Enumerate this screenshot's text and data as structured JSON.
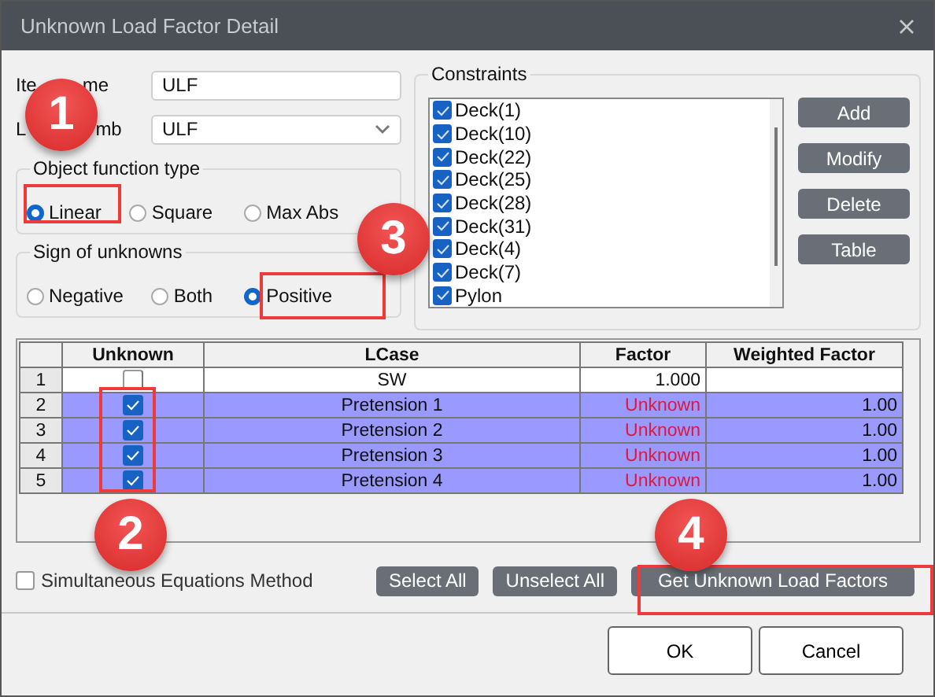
{
  "window": {
    "title": "Unknown Load Factor Detail"
  },
  "fields": [
    {
      "label": [
        "Ite",
        "me"
      ],
      "value": "ULF",
      "kind": "text"
    },
    {
      "label": [
        "L",
        "mb"
      ],
      "value": "ULF",
      "kind": "dropdown"
    }
  ],
  "function_type": {
    "title": "Object function type",
    "options": [
      {
        "label": "Linear",
        "selected": true
      },
      {
        "label": "Square",
        "selected": false
      },
      {
        "label": "Max Abs",
        "selected": false
      }
    ]
  },
  "sign": {
    "title": "Sign of unknowns",
    "options": [
      {
        "label": "Negative",
        "selected": false
      },
      {
        "label": "Both",
        "selected": false
      },
      {
        "label": "Positive",
        "selected": true
      }
    ]
  },
  "constraints": {
    "title": "Constraints",
    "items": [
      {
        "label": "Deck(1)",
        "checked": true
      },
      {
        "label": "Deck(10)",
        "checked": true
      },
      {
        "label": "Deck(22)",
        "checked": true
      },
      {
        "label": "Deck(25)",
        "checked": true
      },
      {
        "label": "Deck(28)",
        "checked": true
      },
      {
        "label": "Deck(31)",
        "checked": true
      },
      {
        "label": "Deck(4)",
        "checked": true
      },
      {
        "label": "Deck(7)",
        "checked": true
      },
      {
        "label": "Pylon",
        "checked": true
      }
    ],
    "buttons": [
      "Add",
      "Modify",
      "Delete",
      "Table"
    ]
  },
  "table": {
    "columns": [
      "Unknown",
      "LCase",
      "Factor",
      "Weighted Factor"
    ],
    "rows": [
      {
        "number": "1",
        "unknown": false,
        "lcase": "SW",
        "factor": "1.000",
        "selected": false
      },
      {
        "number": "2",
        "unknown": true,
        "lcase": "Pretension 1",
        "factor": "Unknown",
        "weighted": "1.00",
        "selected": true
      },
      {
        "number": "3",
        "unknown": true,
        "lcase": "Pretension 2",
        "factor": "Unknown",
        "weighted": "1.00",
        "selected": true
      },
      {
        "number": "4",
        "unknown": true,
        "lcase": "Pretension 3",
        "factor": "Unknown",
        "weighted": "1.00",
        "selected": true
      },
      {
        "number": "5",
        "unknown": true,
        "lcase": "Pretension 4",
        "factor": "Unknown",
        "weighted": "1.00",
        "selected": true
      }
    ]
  },
  "simultaneous": {
    "label": "Simultaneous Equations Method",
    "checked": false
  },
  "actions": [
    "Select All",
    "Unselect All",
    "Get Unknown Load Factors"
  ],
  "dialog_buttons": [
    "OK",
    "Cancel"
  ],
  "callouts": [
    "1",
    "2",
    "3",
    "4"
  ]
}
